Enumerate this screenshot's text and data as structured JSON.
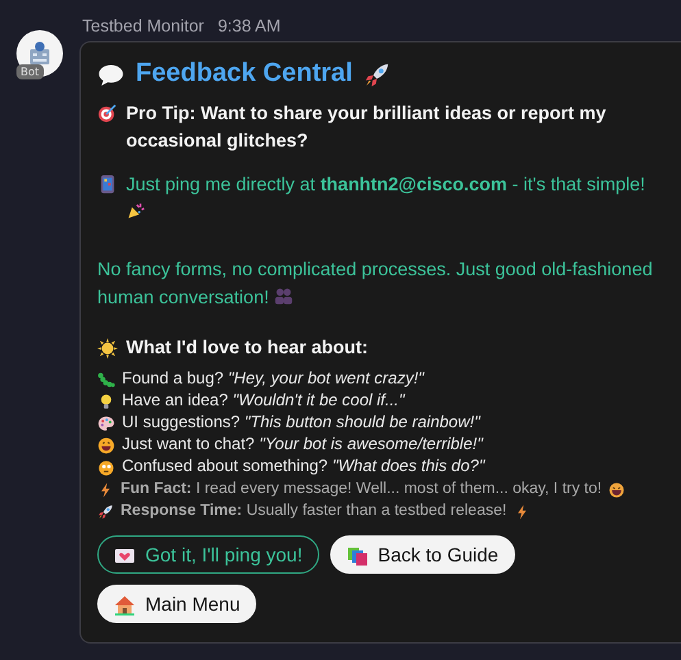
{
  "header": {
    "sender": "Testbed Monitor",
    "time": "9:38 AM",
    "avatar_badge": "Bot"
  },
  "card": {
    "title": "Feedback Central",
    "pro_tip": "Pro Tip: Want to share your brilliant ideas or report my occasional glitches?",
    "contact": "Just ping me directly at **thanhtn2@cisco.com** - it's that simple!",
    "note": "No fancy forms, no complicated processes. Just good old-fashioned human conversation!",
    "list_heading": "What I'd love to hear about:",
    "items": [
      {
        "label": "Found a bug?",
        "quote": "\"Hey, your bot went crazy!\""
      },
      {
        "label": "Have an idea?",
        "quote": "\"Wouldn't it be cool if...\""
      },
      {
        "label": "UI suggestions?",
        "quote": "\"This button should be rainbow!\""
      },
      {
        "label": "Just want to chat?",
        "quote": "\"Your bot is awesome/terrible!\""
      },
      {
        "label": "Confused about something?",
        "quote": "\"What does this do?\""
      }
    ],
    "facts": [
      {
        "label": "Fun Fact:",
        "text": "I read every message! Well... most of them... okay, I try to!"
      },
      {
        "label": "Response Time:",
        "text": "Usually faster than a testbed release!"
      }
    ],
    "buttons": [
      {
        "label": "Got it, I'll ping you!",
        "kind": "outline"
      },
      {
        "label": "Back to Guide",
        "kind": "filled"
      },
      {
        "label": "Main Menu",
        "kind": "filled"
      }
    ]
  }
}
